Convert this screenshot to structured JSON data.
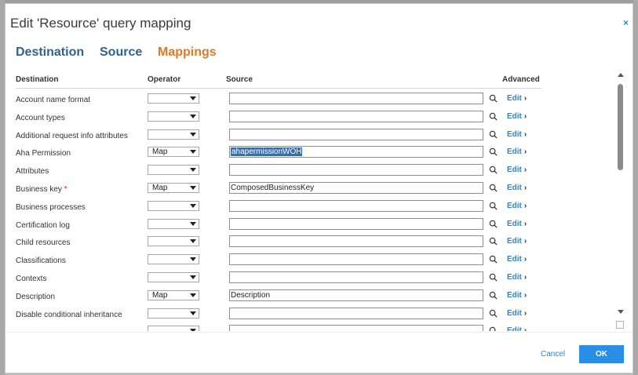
{
  "dialog": {
    "title": "Edit 'Resource' query mapping",
    "close_glyph": "×"
  },
  "tabs": [
    {
      "label": "Destination"
    },
    {
      "label": "Source"
    },
    {
      "label": "Mappings",
      "active": true
    }
  ],
  "table": {
    "headers": {
      "destination": "Destination",
      "operator": "Operator",
      "source": "Source",
      "advanced": "Advanced"
    },
    "edit_label": "Edit",
    "chevron": "›",
    "rows": [
      {
        "destination": "Account name format",
        "required": false,
        "operator": "",
        "source": ""
      },
      {
        "destination": "Account types",
        "required": false,
        "operator": "",
        "source": ""
      },
      {
        "destination": "Additional request info attributes",
        "required": false,
        "operator": "",
        "source": ""
      },
      {
        "destination": "Aha Permission",
        "required": false,
        "operator": "Map",
        "source": "ahapermissionWOH",
        "selected": true
      },
      {
        "destination": "Attributes",
        "required": false,
        "operator": "",
        "source": ""
      },
      {
        "destination": "Business key",
        "required": true,
        "operator": "Map",
        "source": "ComposedBusinessKey"
      },
      {
        "destination": "Business processes",
        "required": false,
        "operator": "",
        "source": ""
      },
      {
        "destination": "Certification log",
        "required": false,
        "operator": "",
        "source": ""
      },
      {
        "destination": "Child resources",
        "required": false,
        "operator": "",
        "source": ""
      },
      {
        "destination": "Classifications",
        "required": false,
        "operator": "",
        "source": ""
      },
      {
        "destination": "Contexts",
        "required": false,
        "operator": "",
        "source": ""
      },
      {
        "destination": "Description",
        "required": false,
        "operator": "Map",
        "source": "Description"
      },
      {
        "destination": "Disable conditional inheritance",
        "required": false,
        "operator": "",
        "source": ""
      },
      {
        "destination": "",
        "required": false,
        "operator": "",
        "source": ""
      }
    ]
  },
  "footer": {
    "cancel_label": "Cancel",
    "ok_label": "OK"
  },
  "colors": {
    "tab_inactive": "#2e628f",
    "tab_active": "#e0782a",
    "link": "#2a86d1",
    "primary_button": "#2a8ee6",
    "selection": "#3b6ca8"
  }
}
